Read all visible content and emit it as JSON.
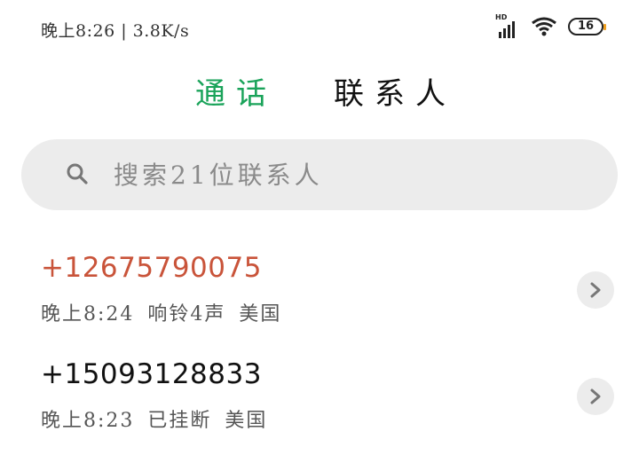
{
  "status_bar": {
    "time": "晚上8:26 | 3.8K/s",
    "network_type": "HD",
    "battery_level": "16",
    "icons": [
      "signal-icon",
      "wifi-icon",
      "battery-icon"
    ]
  },
  "tabs": [
    {
      "label": "通话",
      "active": true
    },
    {
      "label": "联系人",
      "active": false
    }
  ],
  "search": {
    "placeholder": "搜索21位联系人"
  },
  "calls": [
    {
      "number": "+12675790075",
      "time": "晚上8:24",
      "status": "响铃4声",
      "location": "美国",
      "missed": true
    },
    {
      "number": "+15093128833",
      "time": "晚上8:23",
      "status": "已挂断",
      "location": "美国",
      "missed": false
    }
  ],
  "colors": {
    "active_tab": "#1aa35a",
    "missed_number": "#c9543a",
    "search_background": "#ececec"
  }
}
